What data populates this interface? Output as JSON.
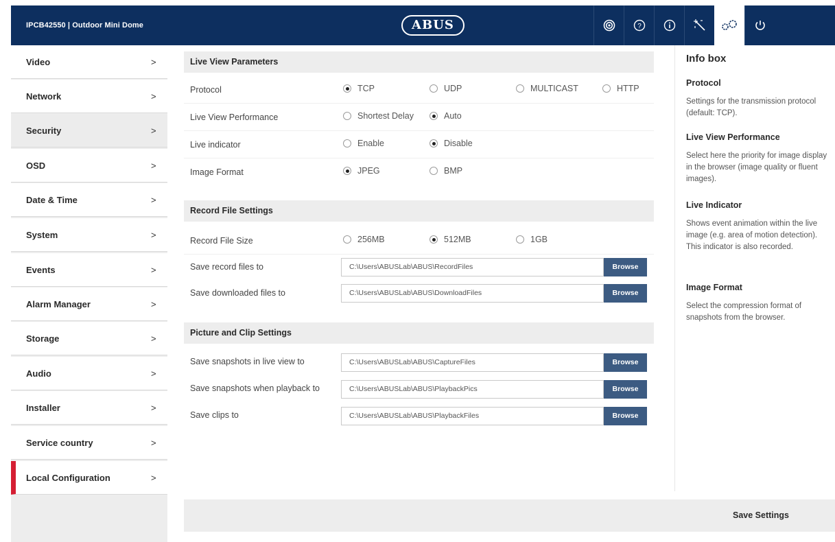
{
  "header": {
    "device_title": "IPCB42550 | Outdoor Mini Dome",
    "logo_text": "ABUS",
    "buttons": [
      {
        "icon": "live-view-icon"
      },
      {
        "icon": "help-icon"
      },
      {
        "icon": "info-icon"
      },
      {
        "icon": "wizard-icon"
      },
      {
        "icon": "settings-icon",
        "active": true
      },
      {
        "icon": "power-icon"
      }
    ]
  },
  "sidebar": {
    "items": [
      {
        "label": "Video",
        "chevron": ">"
      },
      {
        "label": "Network",
        "chevron": ">"
      },
      {
        "label": "Security",
        "chevron": ">"
      },
      {
        "label": "OSD",
        "chevron": ">"
      },
      {
        "label": "Date & Time",
        "chevron": ">"
      },
      {
        "label": "System",
        "chevron": ">"
      },
      {
        "label": "Events",
        "chevron": ">"
      },
      {
        "label": "Alarm Manager",
        "chevron": ">"
      },
      {
        "label": "Storage",
        "chevron": ">"
      },
      {
        "label": "Audio",
        "chevron": ">"
      },
      {
        "label": "Installer",
        "chevron": ">"
      },
      {
        "label": "Service country",
        "chevron": ">"
      },
      {
        "label": "Local Configuration",
        "chevron": ">",
        "active": true
      }
    ]
  },
  "live_view": {
    "title": "Live View Parameters",
    "protocol": {
      "label": "Protocol",
      "options": [
        "TCP",
        "UDP",
        "MULTICAST",
        "HTTP"
      ],
      "selected": "TCP"
    },
    "performance": {
      "label": "Live View Performance",
      "options": [
        "Shortest Delay",
        "Auto"
      ],
      "selected": "Auto"
    },
    "indicator": {
      "label": "Live indicator",
      "options": [
        "Enable",
        "Disable"
      ],
      "selected": "Disable"
    },
    "image_format": {
      "label": "Image Format",
      "options": [
        "JPEG",
        "BMP"
      ],
      "selected": "JPEG"
    }
  },
  "record": {
    "title": "Record File Settings",
    "file_size": {
      "label": "Record File Size",
      "options": [
        "256MB",
        "512MB",
        "1GB"
      ],
      "selected": "512MB"
    },
    "save_record": {
      "label": "Save record files to",
      "value": "C:\\Users\\ABUSLab\\ABUS\\RecordFiles"
    },
    "save_downloaded": {
      "label": "Save downloaded files to",
      "value": "C:\\Users\\ABUSLab\\ABUS\\DownloadFiles"
    }
  },
  "picture": {
    "title": "Picture and Clip Settings",
    "snap_live": {
      "label": "Save snapshots in live view to",
      "value": "C:\\Users\\ABUSLab\\ABUS\\CaptureFiles"
    },
    "snap_playback": {
      "label": "Save snapshots when playback to",
      "value": "C:\\Users\\ABUSLab\\ABUS\\PlaybackPics"
    },
    "clips": {
      "label": "Save clips to",
      "value": "C:\\Users\\ABUSLab\\ABUS\\PlaybackFiles"
    }
  },
  "browse_label": "Browse",
  "info_box": {
    "title": "Info box",
    "sections": [
      {
        "heading": "Protocol",
        "text": "Settings for the transmission protocol (default: TCP)."
      },
      {
        "heading": "Live View Performance",
        "text": "Select here the priority for image display in the browser (image quality or fluent images)."
      },
      {
        "heading": "Live Indicator",
        "text": "Shows event animation within the live image (e.g. area of motion detection). This indicator is also recorded."
      },
      {
        "heading": "Image Format",
        "text": "Select the compression format of snapshots from the browser."
      }
    ]
  },
  "footer": {
    "save_label": "Save Settings"
  },
  "colors": {
    "header_bg": "#0d2f5f",
    "accent_red": "#d51e33",
    "browse_bg": "#3c5b82"
  }
}
